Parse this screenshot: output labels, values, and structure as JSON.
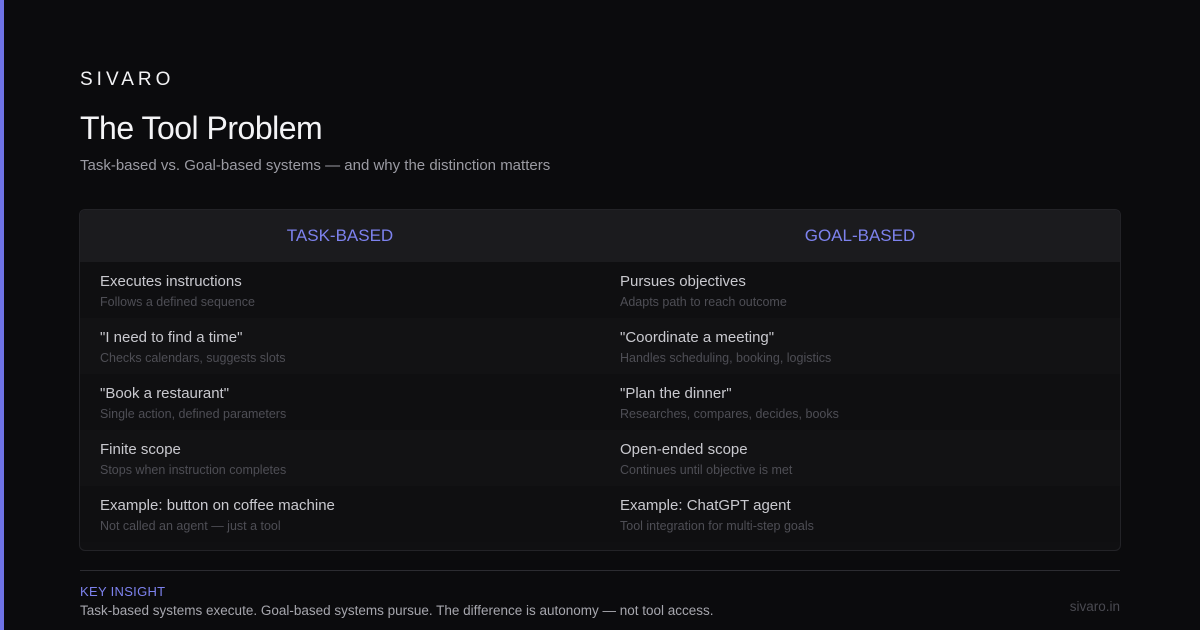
{
  "brand": "SIVARO",
  "title": "The Tool Problem",
  "subtitle": "Task-based vs. Goal-based systems — and why the distinction matters",
  "colors": {
    "accent": "#6f73e6",
    "header_text": "#7d82ee",
    "background": "#0b0b0d"
  },
  "columns": [
    {
      "heading": "TASK-BASED",
      "rows": [
        {
          "main": "Executes instructions",
          "sub": "Follows a defined sequence"
        },
        {
          "main": "\"I need to find a time\"",
          "sub": "Checks calendars, suggests slots"
        },
        {
          "main": "\"Book a restaurant\"",
          "sub": "Single action, defined parameters"
        },
        {
          "main": "Finite scope",
          "sub": "Stops when instruction completes"
        },
        {
          "main": "Example: button on coffee machine",
          "sub": "Not called an agent — just a tool"
        }
      ]
    },
    {
      "heading": "GOAL-BASED",
      "rows": [
        {
          "main": "Pursues objectives",
          "sub": "Adapts path to reach outcome"
        },
        {
          "main": "\"Coordinate a meeting\"",
          "sub": "Handles scheduling, booking, logistics"
        },
        {
          "main": "\"Plan the dinner\"",
          "sub": "Researches, compares, decides, books"
        },
        {
          "main": "Open-ended scope",
          "sub": "Continues until objective is met"
        },
        {
          "main": "Example: ChatGPT agent",
          "sub": "Tool integration for multi-step goals"
        }
      ]
    }
  ],
  "insight": {
    "label": "KEY INSIGHT",
    "text": "Task-based systems execute. Goal-based systems pursue. The difference is autonomy — not tool access."
  },
  "site": "sivaro.in"
}
